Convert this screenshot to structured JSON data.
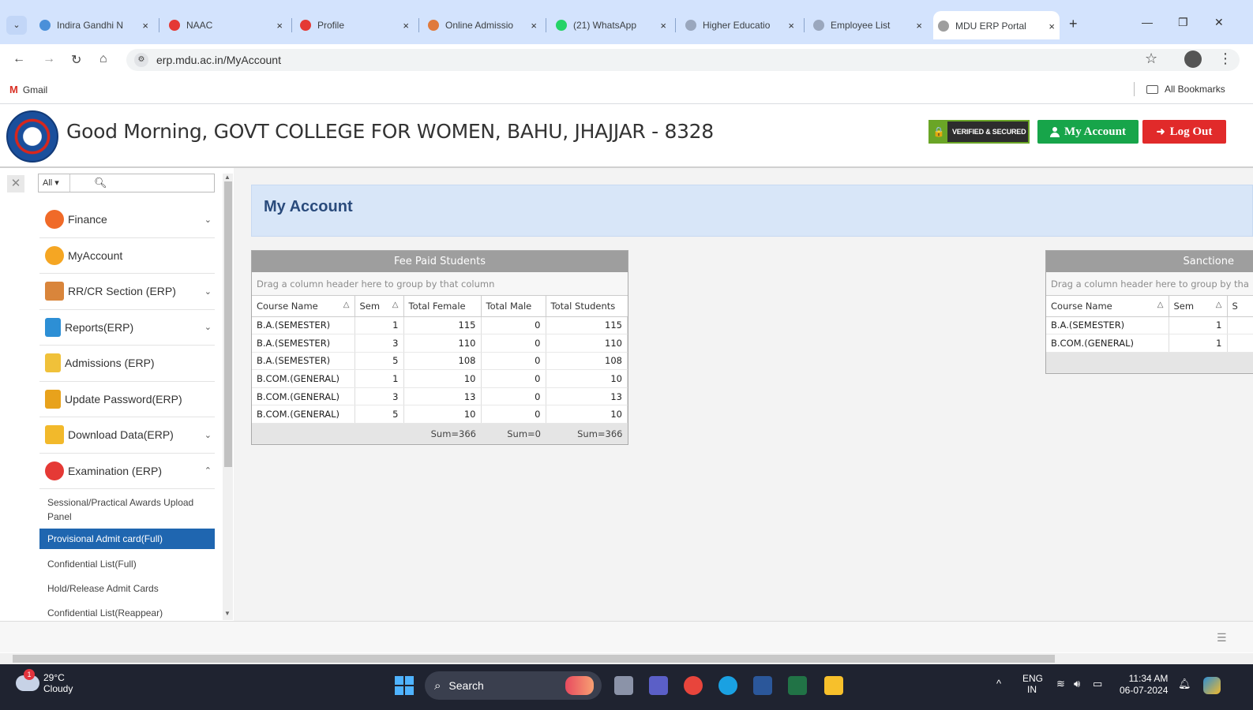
{
  "browser": {
    "tabs": [
      {
        "label": "Indira Gandhi N",
        "close": "×",
        "favicon_color": "#4a90d9"
      },
      {
        "label": "NAAC",
        "close": "×",
        "favicon_color": "#e53935"
      },
      {
        "label": "Profile",
        "close": "×",
        "favicon_color": "#e53935"
      },
      {
        "label": "Online Admissio",
        "close": "×",
        "favicon_color": "#e07a3c"
      },
      {
        "label": "(21) WhatsApp",
        "close": "×",
        "favicon_color": "#25d366"
      },
      {
        "label": "Higher Educatio",
        "close": "×",
        "favicon_color": "#9aa7bd"
      },
      {
        "label": "Employee List",
        "close": "×",
        "favicon_color": "#9aa7bd"
      },
      {
        "label": "MDU ERP Portal",
        "close": "×",
        "favicon_color": "#9e9e9e"
      }
    ],
    "new_tab": "+",
    "url": "erp.mdu.ac.in/MyAccount",
    "bookmarks": {
      "gmail": "Gmail",
      "all": "All Bookmarks"
    }
  },
  "header": {
    "greeting": "Good Morning, GOVT COLLEGE FOR WOMEN, BAHU, JHAJJAR - 8328",
    "verified_text": "VERIFIED & SECURED",
    "my_account_label": "My Account",
    "logout_label": "Log Out",
    "colors": {
      "my_account": "#17a54a",
      "logout": "#e12a2a"
    }
  },
  "sidebar": {
    "search_filter": "All",
    "menu": [
      {
        "label": "Finance",
        "icon": "finance-icon",
        "color": "#f06a28",
        "chevron": "⌄"
      },
      {
        "label": "MyAccount",
        "icon": "user-icon",
        "color": "#f5a623",
        "chevron": ""
      },
      {
        "label": "RR/CR Section (ERP)",
        "icon": "building-icon",
        "color": "#d9853b",
        "chevron": "⌄"
      },
      {
        "label": "Reports(ERP)",
        "icon": "report-icon",
        "color": "#2d8fd5",
        "chevron": "⌄"
      },
      {
        "label": "Admissions (ERP)",
        "icon": "admission-icon",
        "color": "#f0c13a",
        "chevron": ""
      },
      {
        "label": "Update Password(ERP)",
        "icon": "lock-icon",
        "color": "#e8a21c",
        "chevron": ""
      },
      {
        "label": "Download Data(ERP)",
        "icon": "folder-icon",
        "color": "#f2b92b",
        "chevron": "⌄"
      },
      {
        "label": "Examination (ERP)",
        "icon": "exam-icon",
        "color": "#e53935",
        "chevron": "⌃"
      }
    ],
    "submenu": [
      {
        "label": "Sessional/Practical Awards Upload Panel",
        "active": false
      },
      {
        "label": "Provisional Admit card(Full)",
        "active": true
      },
      {
        "label": "Confidential List(Full)",
        "active": false
      },
      {
        "label": "Hold/Release Admit Cards",
        "active": false
      },
      {
        "label": "Confidential List(Reappear)",
        "active": false
      }
    ]
  },
  "main": {
    "title": "My Account",
    "fee_grid": {
      "title": "Fee Paid Students",
      "group_hint": "Drag a column header here to group by that column",
      "columns": [
        "Course Name",
        "Sem",
        "Total Female",
        "Total Male",
        "Total Students"
      ],
      "rows": [
        [
          "B.A.(SEMESTER)",
          "1",
          "115",
          "0",
          "115"
        ],
        [
          "B.A.(SEMESTER)",
          "3",
          "110",
          "0",
          "110"
        ],
        [
          "B.A.(SEMESTER)",
          "5",
          "108",
          "0",
          "108"
        ],
        [
          "B.COM.(GENERAL)",
          "1",
          "10",
          "0",
          "10"
        ],
        [
          "B.COM.(GENERAL)",
          "3",
          "13",
          "0",
          "13"
        ],
        [
          "B.COM.(GENERAL)",
          "5",
          "10",
          "0",
          "10"
        ]
      ],
      "footer": {
        "female": "Sum=366",
        "male": "Sum=0",
        "total": "Sum=366"
      }
    },
    "sanction_grid": {
      "title": "Sanctione",
      "group_hint": "Drag a column header here to group by tha",
      "columns": [
        "Course Name",
        "Sem",
        "S"
      ],
      "rows": [
        [
          "B.A.(SEMESTER)",
          "1",
          ""
        ],
        [
          "B.COM.(GENERAL)",
          "1",
          ""
        ]
      ]
    }
  },
  "taskbar": {
    "temp": "29°C",
    "weather": "Cloudy",
    "weather_badge": "1",
    "search": "Search",
    "lang_top": "ENG",
    "lang_bottom": "IN",
    "time": "11:34 AM",
    "date": "06-07-2024"
  }
}
